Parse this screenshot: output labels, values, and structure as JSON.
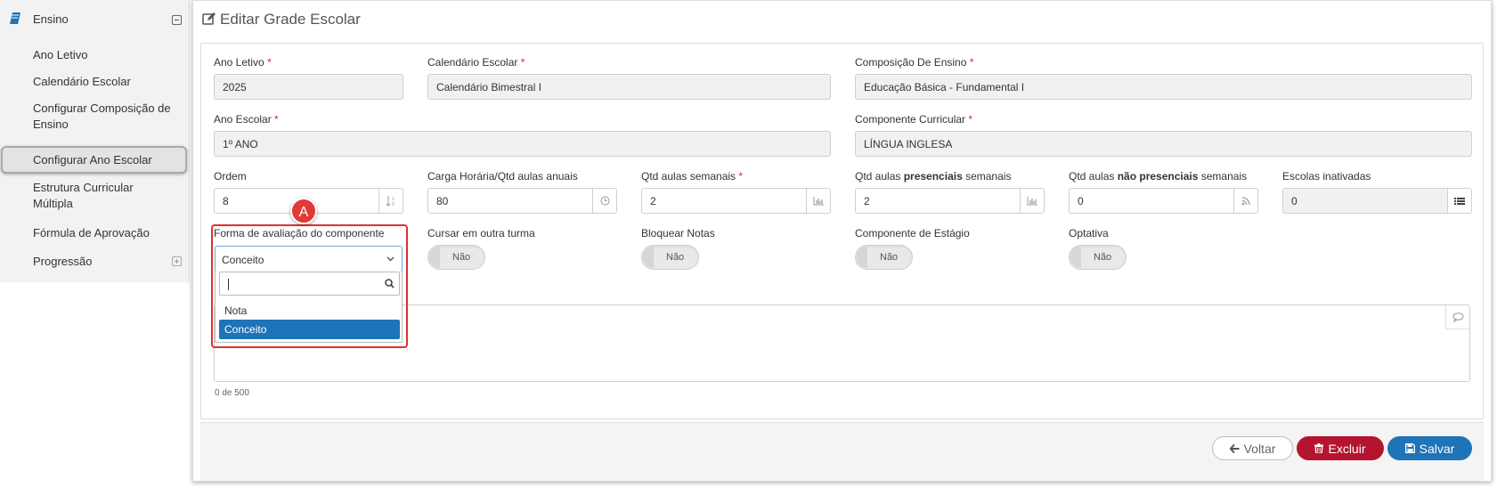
{
  "sidebar": {
    "header": "Ensino",
    "items": [
      {
        "label": "Ano Letivo"
      },
      {
        "label": "Calendário Escolar"
      },
      {
        "label": "Configurar Composição de Ensino"
      },
      {
        "label": "Configurar Ano Escolar",
        "active": true
      },
      {
        "label": "Estrutura Curricular Múltipla"
      },
      {
        "label": "Fórmula de Aprovação"
      },
      {
        "label": "Progressão"
      }
    ]
  },
  "page": {
    "title": "Editar Grade Escolar"
  },
  "form": {
    "ano_letivo": {
      "label": "Ano Letivo",
      "required": "*",
      "value": "2025"
    },
    "calendario": {
      "label": "Calendário Escolar",
      "required": "*",
      "value": "Calendário Bimestral I"
    },
    "composicao": {
      "label": "Composição De Ensino",
      "required": "*",
      "value": "Educação Básica - Fundamental I"
    },
    "ano_escolar": {
      "label": "Ano Escolar",
      "required": "*",
      "value": "1º ANO"
    },
    "componente": {
      "label": "Componente Curricular",
      "required": "*",
      "value": "LÍNGUA INGLESA"
    },
    "ordem": {
      "label": "Ordem",
      "value": "8"
    },
    "carga": {
      "label": "Carga Horária/Qtd aulas anuais",
      "value": "80"
    },
    "qtd_semanais": {
      "label": "Qtd aulas semanais",
      "required": "*",
      "value": "2"
    },
    "qtd_presenciais": {
      "label_pre": "Qtd aulas ",
      "label_bold": "presenciais",
      "label_post": " semanais",
      "value": "2"
    },
    "qtd_nao_presenciais": {
      "label_pre": "Qtd aulas ",
      "label_bold": "não presenciais",
      "label_post": " semanais",
      "value": "0"
    },
    "escolas_inativadas": {
      "label": "Escolas inativadas",
      "value": "0"
    },
    "forma_avaliacao": {
      "label": "Forma de avaliação do componente",
      "selected": "Conceito",
      "search_value": "",
      "options": [
        "Nota",
        "Conceito"
      ]
    },
    "cursar_outra": {
      "label": "Cursar em outra turma",
      "state": "Não"
    },
    "bloquear_notas": {
      "label": "Bloquear Notas",
      "state": "Não"
    },
    "estagio": {
      "label": "Componente de Estágio",
      "state": "Não"
    },
    "optativa": {
      "label": "Optativa",
      "state": "Não"
    },
    "observacao": {
      "counter": "0 de 500"
    }
  },
  "annotation": {
    "badge": "A"
  },
  "footer": {
    "back": "Voltar",
    "delete": "Excluir",
    "save": "Salvar"
  },
  "colors": {
    "primary": "#1f73b7",
    "danger": "#b5142f",
    "required": "#e0262e",
    "highlight": "#e03030"
  }
}
